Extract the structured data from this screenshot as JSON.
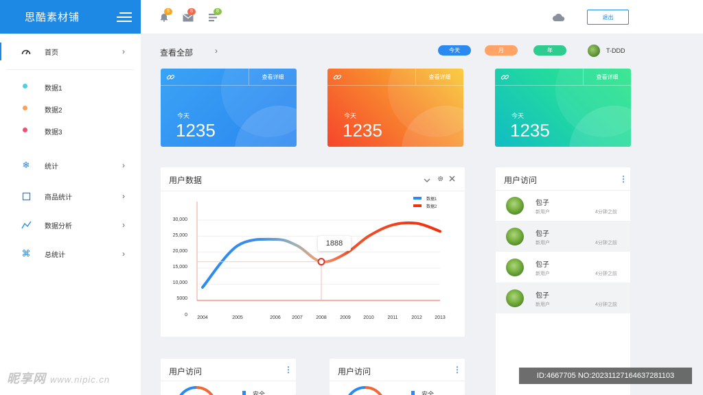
{
  "brand": {
    "title": "思酷素材铺"
  },
  "sidebar": {
    "items": [
      {
        "label": "首页",
        "icon": "gauge-icon"
      },
      {
        "label": "统计",
        "icon": "snowflake-icon"
      },
      {
        "label": "商品统计",
        "icon": "square-icon"
      },
      {
        "label": "数据分析",
        "icon": "trend-icon"
      },
      {
        "label": "总统计",
        "icon": "command-icon"
      }
    ],
    "sub_items": [
      {
        "label": "数据1",
        "color": "#4dd0e1"
      },
      {
        "label": "数据2",
        "color": "#ff9f5a"
      },
      {
        "label": "数据3",
        "color": "#f0506e"
      }
    ]
  },
  "topbar": {
    "badges": [
      {
        "icon": "bell-icon",
        "count": "8",
        "color": "#f5a623"
      },
      {
        "icon": "mail-icon",
        "count": "8",
        "color": "#f06a4f"
      },
      {
        "icon": "list-icon",
        "count": "8",
        "color": "#8bc34a"
      }
    ],
    "logout_label": "退出"
  },
  "header": {
    "view_all": "查看全部",
    "filters": [
      {
        "label": "今天",
        "color": "#2b8af0"
      },
      {
        "label": "月",
        "color": "#ffa366"
      },
      {
        "label": "年",
        "color": "#2ecc8f"
      }
    ],
    "user_name": "T-DDD"
  },
  "stat_cards": [
    {
      "detail_label": "查看详细",
      "today_label": "今天",
      "value": "1235",
      "gradient": [
        "#2b8ff5",
        "#3aaef0"
      ]
    },
    {
      "detail_label": "查看详细",
      "today_label": "今天",
      "value": "1235",
      "gradient": [
        "#f6592b",
        "#f9c935"
      ]
    },
    {
      "detail_label": "查看详细",
      "today_label": "今天",
      "value": "1235",
      "gradient": [
        "#18c9b0",
        "#2ee58a"
      ]
    }
  ],
  "chart_panel": {
    "title": "用户数据",
    "tooltip": "1888"
  },
  "chart_data": {
    "type": "line",
    "title": "用户数据",
    "x": [
      "2004",
      "2005",
      "2006",
      "2007",
      "2008",
      "2009",
      "2010",
      "2011",
      "2012",
      "2013"
    ],
    "series": [
      {
        "name": "数据1",
        "color": "#2b8af0",
        "values": [
          9000,
          22000,
          24000,
          22000,
          17000,
          19500,
          25000,
          28500,
          29000,
          26500
        ]
      },
      {
        "name": "数据2",
        "color": "#ef2f10",
        "values": []
      }
    ],
    "y_ticks": [
      "30,000",
      "25,000",
      "20,000",
      "15,000",
      "10,000",
      "5000",
      "0"
    ],
    "ylim": [
      0,
      30000
    ],
    "highlight": {
      "x": "2008",
      "value": 1888
    },
    "grid": true,
    "legend": "top-right"
  },
  "visit_panel": {
    "title": "用户访问",
    "rows": [
      {
        "name": "包子",
        "type": "新用户",
        "time": "4分钟之前"
      },
      {
        "name": "包子",
        "type": "新用户",
        "time": "4分钟之前"
      },
      {
        "name": "包子",
        "type": "新用户",
        "time": "4分钟之前"
      },
      {
        "name": "包子",
        "type": "新用户",
        "time": "4分钟之前"
      }
    ]
  },
  "bottom_panels": [
    {
      "title": "用户访问",
      "item": "安全"
    },
    {
      "title": "用户访问",
      "item": "安全"
    }
  ],
  "watermark": {
    "text": "昵享网",
    "url": "www.nipic.cn"
  },
  "id_bar": "ID:4667705 NO:20231127164637281103"
}
